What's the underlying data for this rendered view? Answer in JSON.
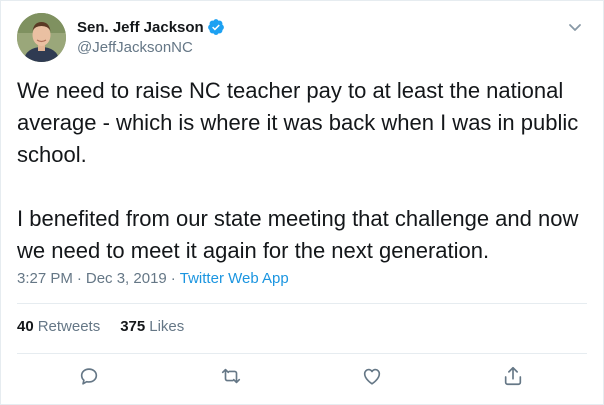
{
  "author": {
    "display_name": "Sen. Jeff Jackson",
    "handle": "@JeffJacksonNC",
    "verified": true,
    "avatar_icon": "profile-photo"
  },
  "tweet": {
    "text": "We need to raise NC teacher pay to at least the national average - which is where it was back when I was in public school.\n\nI benefited from our state meeting that challenge and now we need to meet it again for the next generation.",
    "time": "3:27 PM",
    "separator": "·",
    "date": "Dec 3, 2019",
    "source": "Twitter Web App"
  },
  "stats": {
    "retweets_count": "40",
    "retweets_label": "Retweets",
    "likes_count": "375",
    "likes_label": "Likes"
  },
  "icons": {
    "verified": "verified-badge-icon",
    "menu": "chevron-down-icon",
    "reply": "reply-icon",
    "retweet": "retweet-icon",
    "like": "heart-icon",
    "share": "share-icon"
  },
  "colors": {
    "text": "#14171a",
    "muted": "#657786",
    "link": "#1b95e0",
    "verified": "#1da1f2",
    "border": "#e6ecf0"
  }
}
